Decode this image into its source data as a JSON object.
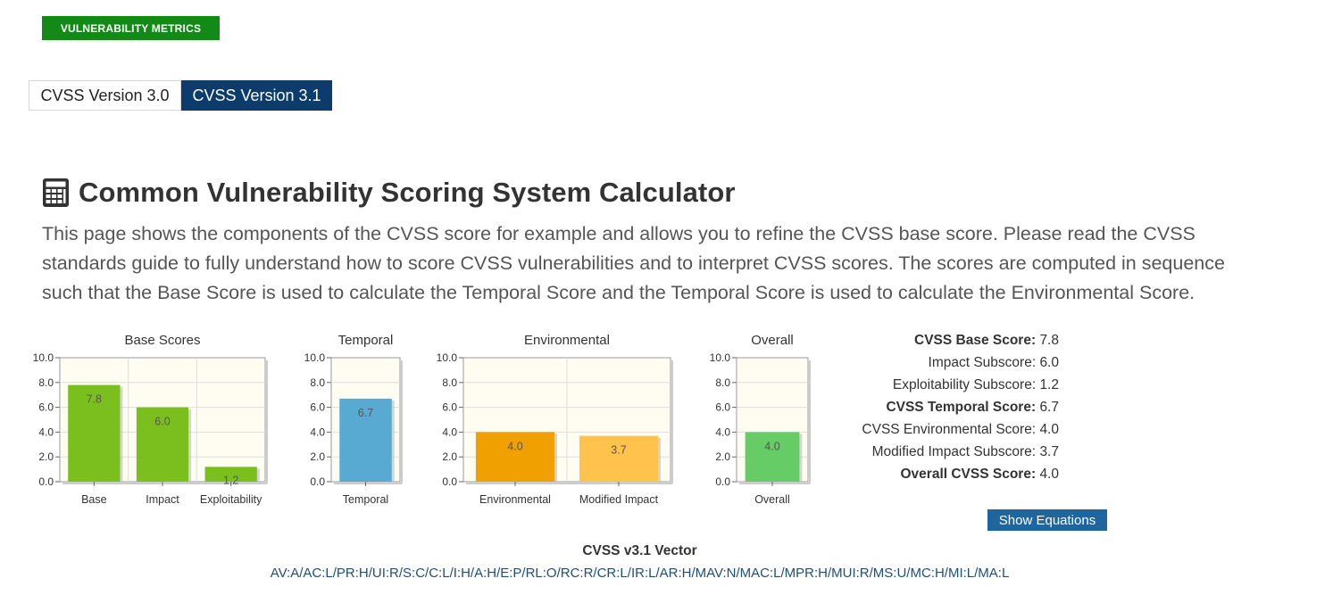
{
  "header": {
    "badge": "VULNERABILITY METRICS"
  },
  "tabs": [
    {
      "label": "CVSS Version 3.0",
      "active": false
    },
    {
      "label": "CVSS Version 3.1",
      "active": true
    }
  ],
  "title": "Common Vulnerability Scoring System Calculator",
  "intro": "This page shows the components of the CVSS score for example and allows you to refine the CVSS base score. Please read the CVSS standards guide to fully understand how to score CVSS vulnerabilities and to interpret CVSS scores. The scores are computed in sequence such that the Base Score is used to calculate the Temporal Score and the Temporal Score is used to calculate the Environmental Score.",
  "colors": {
    "badge": "#138a17",
    "tab_active": "#0b3c6b",
    "button": "#1f669f",
    "base": "#7bbf1f",
    "temporal": "#58aad3",
    "environmental": "#f0a000",
    "modified_impact": "#ffc34d",
    "overall": "#66cc66",
    "plot_bg": "#fffdf2"
  },
  "chart_data": [
    {
      "type": "bar",
      "title": "Base Scores",
      "categories": [
        "Base",
        "Impact",
        "Exploitability"
      ],
      "values": [
        7.8,
        6.0,
        1.2
      ],
      "ylim": [
        0,
        10
      ],
      "yticks": [
        "0.0",
        "2.0",
        "4.0",
        "6.0",
        "8.0",
        "10.0"
      ],
      "grid": true
    },
    {
      "type": "bar",
      "title": "Temporal",
      "categories": [
        "Temporal"
      ],
      "values": [
        6.7
      ],
      "ylim": [
        0,
        10
      ],
      "yticks": [
        "0.0",
        "2.0",
        "4.0",
        "6.0",
        "8.0",
        "10.0"
      ],
      "grid": true
    },
    {
      "type": "bar",
      "title": "Environmental",
      "categories": [
        "Environmental",
        "Modified Impact"
      ],
      "values": [
        4.0,
        3.7
      ],
      "ylim": [
        0,
        10
      ],
      "yticks": [
        "0.0",
        "2.0",
        "4.0",
        "6.0",
        "8.0",
        "10.0"
      ],
      "grid": true
    },
    {
      "type": "bar",
      "title": "Overall",
      "categories": [
        "Overall"
      ],
      "values": [
        4.0
      ],
      "ylim": [
        0,
        10
      ],
      "yticks": [
        "0.0",
        "2.0",
        "4.0",
        "6.0",
        "8.0",
        "10.0"
      ],
      "grid": true
    }
  ],
  "scores": [
    {
      "label": "CVSS Base Score:",
      "value": "7.8",
      "bold": true
    },
    {
      "label": "Impact Subscore:",
      "value": "6.0",
      "bold": false
    },
    {
      "label": "Exploitability Subscore:",
      "value": "1.2",
      "bold": false
    },
    {
      "label": "CVSS Temporal Score:",
      "value": "6.7",
      "bold": true
    },
    {
      "label": "CVSS Environmental Score:",
      "value": "4.0",
      "bold": false
    },
    {
      "label": "Modified Impact Subscore:",
      "value": "3.7",
      "bold": false
    },
    {
      "label": "Overall CVSS Score:",
      "value": "4.0",
      "bold": true
    }
  ],
  "show_equations_label": "Show Equations",
  "vector": {
    "title": "CVSS v3.1 Vector",
    "value": "AV:A/AC:L/PR:H/UI:R/S:C/C:L/I:H/A:H/E:P/RL:O/RC:R/CR:L/IR:L/AR:H/MAV:N/MAC:L/MPR:H/MUI:R/MS:U/MC:H/MI:L/MA:L"
  }
}
